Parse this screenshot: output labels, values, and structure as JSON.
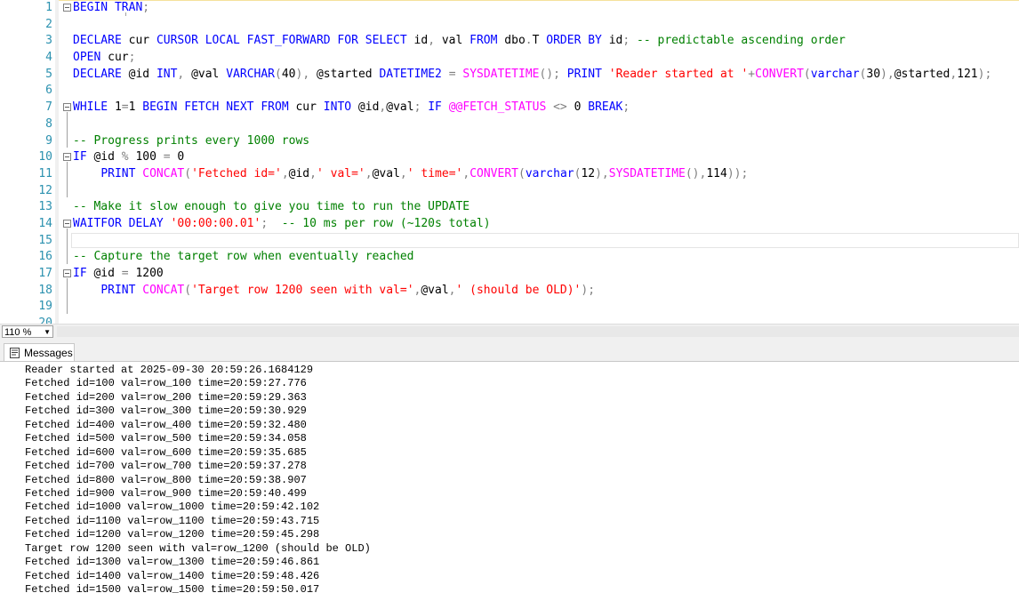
{
  "editor": {
    "line_numbers": [
      "1",
      "2",
      "3",
      "4",
      "5",
      "6",
      "7",
      "8",
      "9",
      "10",
      "11",
      "12",
      "13",
      "14",
      "15",
      "16",
      "17",
      "18",
      "19",
      "20"
    ],
    "lines": [
      [
        {
          "t": "BEGIN TRAN",
          "c": "kw"
        },
        {
          "t": ";",
          "c": "gr"
        }
      ],
      [],
      [
        {
          "t": "DECLARE",
          "c": "kw"
        },
        {
          "t": " cur ",
          "c": ""
        },
        {
          "t": "CURSOR LOCAL FAST_FORWARD FOR SELECT",
          "c": "kw"
        },
        {
          "t": " id",
          "c": ""
        },
        {
          "t": ",",
          "c": "gr"
        },
        {
          "t": " val ",
          "c": ""
        },
        {
          "t": "FROM",
          "c": "kw"
        },
        {
          "t": " dbo",
          "c": ""
        },
        {
          "t": ".",
          "c": "gr"
        },
        {
          "t": "T ",
          "c": ""
        },
        {
          "t": "ORDER BY",
          "c": "kw"
        },
        {
          "t": " id",
          "c": ""
        },
        {
          "t": ";",
          "c": "gr"
        },
        {
          "t": " -- predictable ascending order",
          "c": "cm"
        }
      ],
      [
        {
          "t": "OPEN",
          "c": "kw"
        },
        {
          "t": " cur",
          "c": ""
        },
        {
          "t": ";",
          "c": "gr"
        }
      ],
      [
        {
          "t": "DECLARE",
          "c": "kw"
        },
        {
          "t": " @id ",
          "c": ""
        },
        {
          "t": "INT",
          "c": "kw"
        },
        {
          "t": ",",
          "c": "gr"
        },
        {
          "t": " @val ",
          "c": ""
        },
        {
          "t": "VARCHAR",
          "c": "kw"
        },
        {
          "t": "(",
          "c": "gr"
        },
        {
          "t": "40",
          "c": ""
        },
        {
          "t": "),",
          "c": "gr"
        },
        {
          "t": " @started ",
          "c": ""
        },
        {
          "t": "DATETIME2",
          "c": "kw"
        },
        {
          "t": " = ",
          "c": "gr"
        },
        {
          "t": "SYSDATETIME",
          "c": "fn"
        },
        {
          "t": "();",
          "c": "gr"
        },
        {
          "t": " ",
          "c": ""
        },
        {
          "t": "PRINT",
          "c": "kw"
        },
        {
          "t": " ",
          "c": ""
        },
        {
          "t": "'Reader started at '",
          "c": "str"
        },
        {
          "t": "+",
          "c": "gr"
        },
        {
          "t": "CONVERT",
          "c": "fn"
        },
        {
          "t": "(",
          "c": "gr"
        },
        {
          "t": "varchar",
          "c": "kw"
        },
        {
          "t": "(",
          "c": "gr"
        },
        {
          "t": "30",
          "c": ""
        },
        {
          "t": "),",
          "c": "gr"
        },
        {
          "t": "@started",
          "c": ""
        },
        {
          "t": ",",
          "c": "gr"
        },
        {
          "t": "121",
          "c": ""
        },
        {
          "t": ");",
          "c": "gr"
        }
      ],
      [],
      [
        {
          "t": "WHILE",
          "c": "kw"
        },
        {
          "t": " 1",
          "c": ""
        },
        {
          "t": "=",
          "c": "gr"
        },
        {
          "t": "1 ",
          "c": ""
        },
        {
          "t": "BEGIN FETCH NEXT FROM",
          "c": "kw"
        },
        {
          "t": " cur ",
          "c": ""
        },
        {
          "t": "INTO",
          "c": "kw"
        },
        {
          "t": " @id",
          "c": ""
        },
        {
          "t": ",",
          "c": "gr"
        },
        {
          "t": "@val",
          "c": ""
        },
        {
          "t": ";",
          "c": "gr"
        },
        {
          "t": " ",
          "c": ""
        },
        {
          "t": "IF",
          "c": "kw"
        },
        {
          "t": " ",
          "c": ""
        },
        {
          "t": "@@FETCH_STATUS",
          "c": "fn"
        },
        {
          "t": " <> ",
          "c": "gr"
        },
        {
          "t": "0 ",
          "c": ""
        },
        {
          "t": "BREAK",
          "c": "kw"
        },
        {
          "t": ";",
          "c": "gr"
        }
      ],
      [],
      [
        {
          "t": "-- Progress prints every 1000 rows",
          "c": "cm"
        }
      ],
      [
        {
          "t": "IF",
          "c": "kw"
        },
        {
          "t": " @id ",
          "c": ""
        },
        {
          "t": "%",
          "c": "gr"
        },
        {
          "t": " 100 ",
          "c": ""
        },
        {
          "t": "=",
          "c": "gr"
        },
        {
          "t": " 0",
          "c": ""
        }
      ],
      [
        {
          "t": "    ",
          "c": ""
        },
        {
          "t": "PRINT",
          "c": "kw"
        },
        {
          "t": " ",
          "c": ""
        },
        {
          "t": "CONCAT",
          "c": "fn"
        },
        {
          "t": "(",
          "c": "gr"
        },
        {
          "t": "'Fetched id='",
          "c": "str"
        },
        {
          "t": ",",
          "c": "gr"
        },
        {
          "t": "@id",
          "c": ""
        },
        {
          "t": ",",
          "c": "gr"
        },
        {
          "t": "' val='",
          "c": "str"
        },
        {
          "t": ",",
          "c": "gr"
        },
        {
          "t": "@val",
          "c": ""
        },
        {
          "t": ",",
          "c": "gr"
        },
        {
          "t": "' time='",
          "c": "str"
        },
        {
          "t": ",",
          "c": "gr"
        },
        {
          "t": "CONVERT",
          "c": "fn"
        },
        {
          "t": "(",
          "c": "gr"
        },
        {
          "t": "varchar",
          "c": "kw"
        },
        {
          "t": "(",
          "c": "gr"
        },
        {
          "t": "12",
          "c": ""
        },
        {
          "t": "),",
          "c": "gr"
        },
        {
          "t": "SYSDATETIME",
          "c": "fn"
        },
        {
          "t": "(),",
          "c": "gr"
        },
        {
          "t": "114",
          "c": ""
        },
        {
          "t": "));",
          "c": "gr"
        }
      ],
      [],
      [
        {
          "t": "-- Make it slow enough to give you time to run the UPDATE",
          "c": "cm"
        }
      ],
      [
        {
          "t": "WAITFOR DELAY",
          "c": "kw"
        },
        {
          "t": " ",
          "c": ""
        },
        {
          "t": "'00:00:00.01'",
          "c": "str"
        },
        {
          "t": ";",
          "c": "gr"
        },
        {
          "t": "  -- 10 ms per row (~120s total)",
          "c": "cm"
        }
      ],
      [],
      [
        {
          "t": "-- Capture the target row when eventually reached",
          "c": "cm"
        }
      ],
      [
        {
          "t": "IF",
          "c": "kw"
        },
        {
          "t": " @id ",
          "c": ""
        },
        {
          "t": "=",
          "c": "gr"
        },
        {
          "t": " 1200",
          "c": ""
        }
      ],
      [
        {
          "t": "    ",
          "c": ""
        },
        {
          "t": "PRINT",
          "c": "kw"
        },
        {
          "t": " ",
          "c": ""
        },
        {
          "t": "CONCAT",
          "c": "fn"
        },
        {
          "t": "(",
          "c": "gr"
        },
        {
          "t": "'Target row 1200 seen with val='",
          "c": "str"
        },
        {
          "t": ",",
          "c": "gr"
        },
        {
          "t": "@val",
          "c": ""
        },
        {
          "t": ",",
          "c": "gr"
        },
        {
          "t": "' (should be OLD)'",
          "c": "str"
        },
        {
          "t": ");",
          "c": "gr"
        }
      ],
      [],
      []
    ]
  },
  "statusbar": {
    "zoom": "110 %"
  },
  "results": {
    "tab_label": "Messages",
    "lines": [
      "Reader started at 2025-09-30 20:59:26.1684129",
      "Fetched id=100 val=row_100 time=20:59:27.776",
      "Fetched id=200 val=row_200 time=20:59:29.363",
      "Fetched id=300 val=row_300 time=20:59:30.929",
      "Fetched id=400 val=row_400 time=20:59:32.480",
      "Fetched id=500 val=row_500 time=20:59:34.058",
      "Fetched id=600 val=row_600 time=20:59:35.685",
      "Fetched id=700 val=row_700 time=20:59:37.278",
      "Fetched id=800 val=row_800 time=20:59:38.907",
      "Fetched id=900 val=row_900 time=20:59:40.499",
      "Fetched id=1000 val=row_1000 time=20:59:42.102",
      "Fetched id=1100 val=row_1100 time=20:59:43.715",
      "Fetched id=1200 val=row_1200 time=20:59:45.298",
      "Target row 1200 seen with val=row_1200 (should be OLD)",
      "Fetched id=1300 val=row_1300 time=20:59:46.861",
      "Fetched id=1400 val=row_1400 time=20:59:48.426",
      "Fetched id=1500 val=row_1500 time=20:59:50.017"
    ]
  }
}
